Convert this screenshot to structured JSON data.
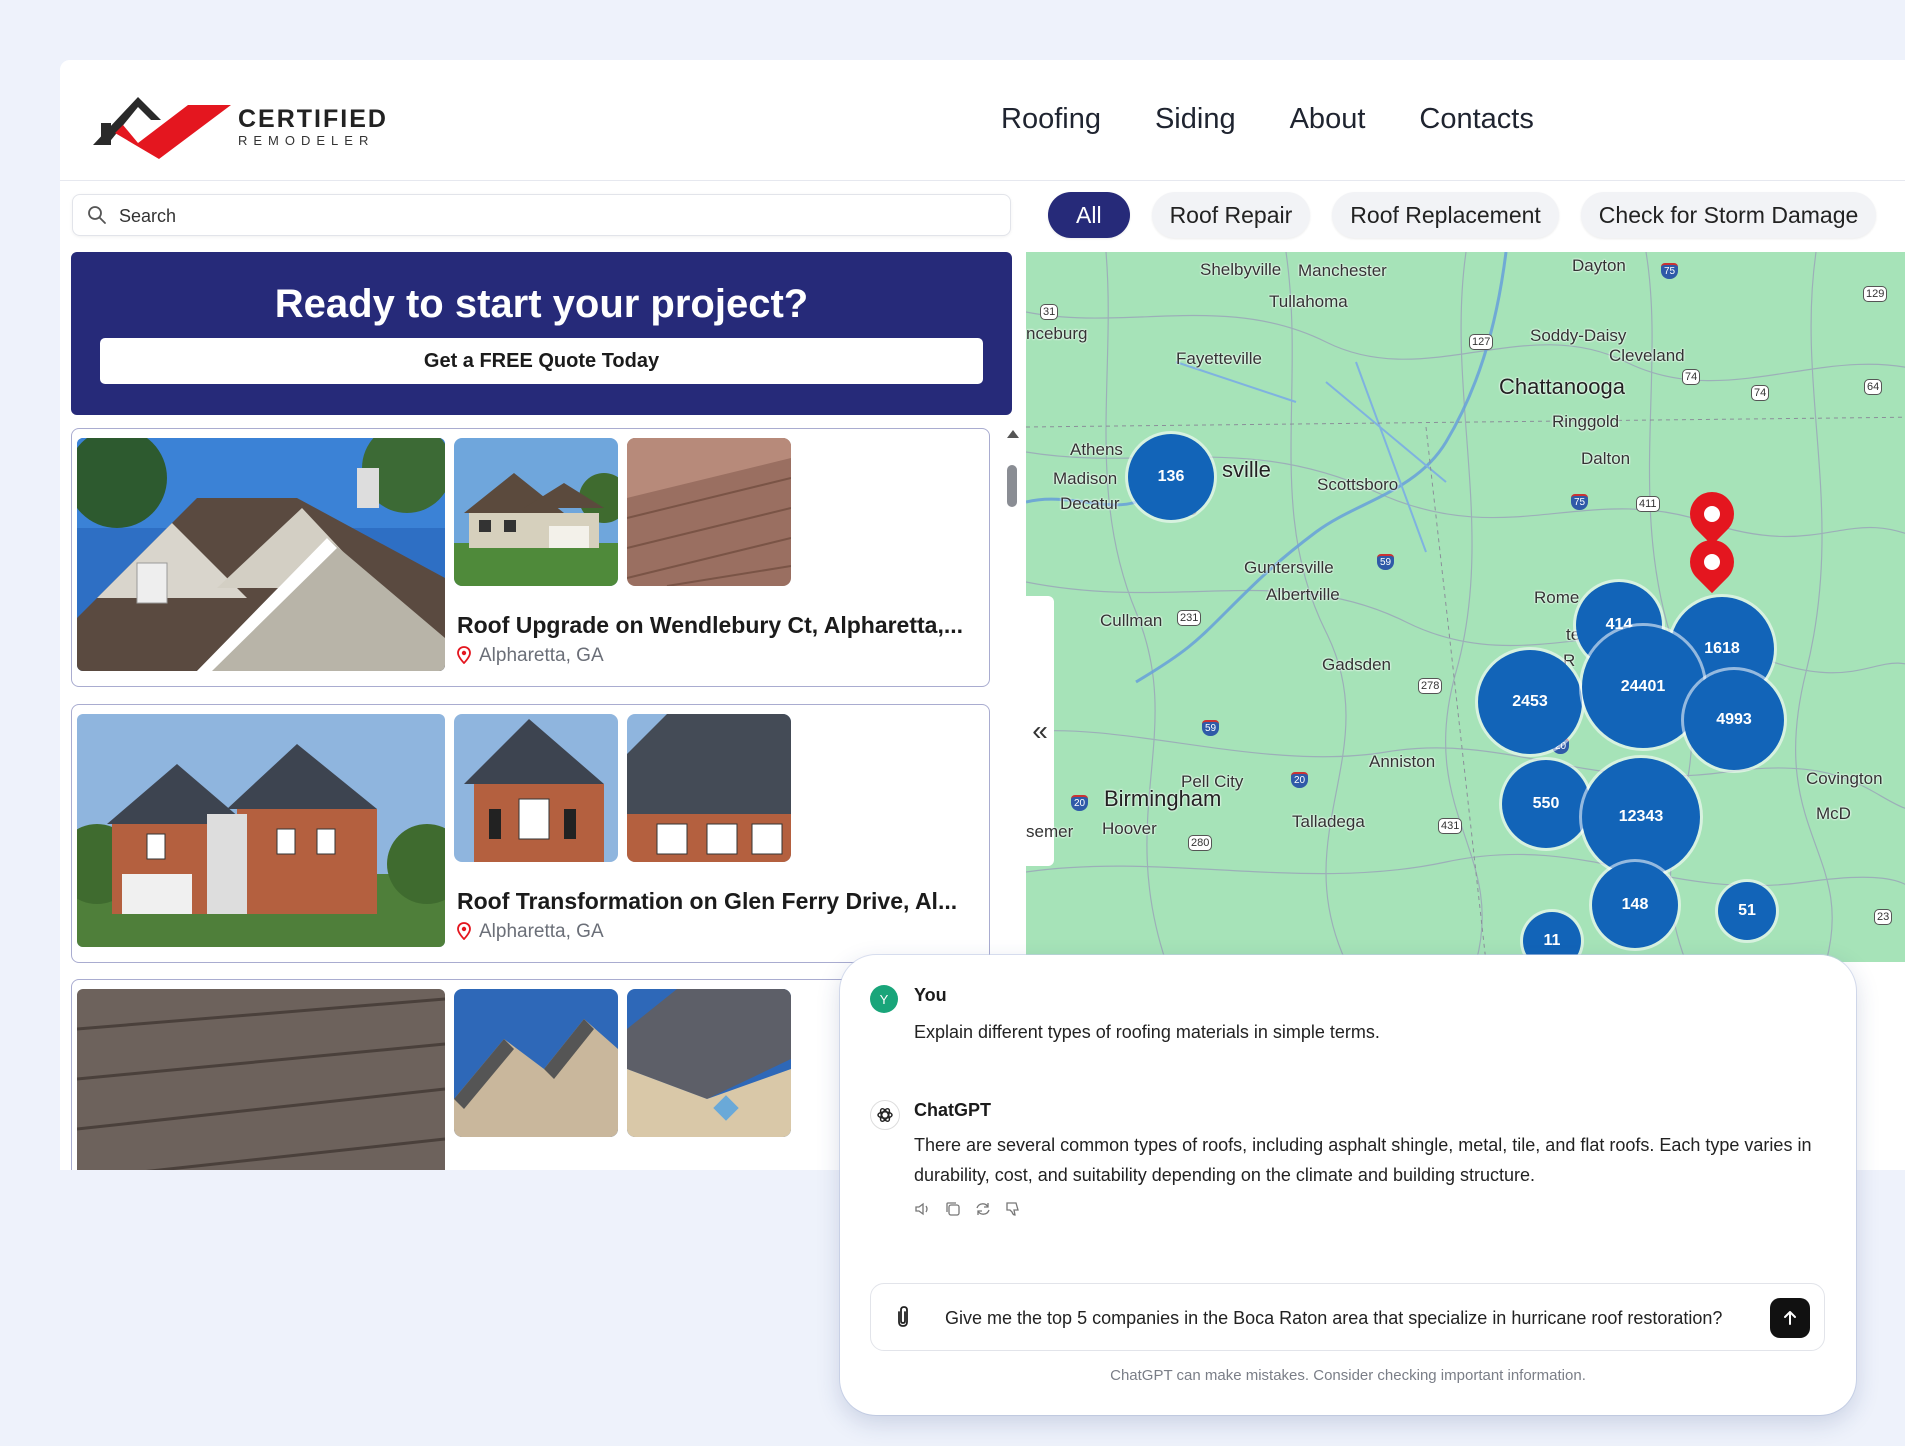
{
  "brand": {
    "title": "CERTIFIED",
    "subtitle": "REMODELER",
    "colors": {
      "primary": "#262a79",
      "accent": "#e4161f",
      "cluster": "#1264b8"
    }
  },
  "nav": [
    "Roofing",
    "Siding",
    "About",
    "Contacts"
  ],
  "search": {
    "placeholder": "Search",
    "icon": "search-icon"
  },
  "cta": {
    "title": "Ready to start your project?",
    "button": "Get a FREE Quote Today"
  },
  "filters": [
    {
      "label": "All",
      "active": true
    },
    {
      "label": "Roof Repair",
      "active": false
    },
    {
      "label": "Roof Replacement",
      "active": false
    },
    {
      "label": "Check for Storm Damage",
      "active": false
    }
  ],
  "listings": [
    {
      "title": "Roof Upgrade on Wendlebury Ct, Alpharetta,...",
      "location": "Alpharetta, GA"
    },
    {
      "title": "Roof Transformation on Glen Ferry Drive, Al...",
      "location": "Alpharetta, GA"
    },
    {
      "title": "",
      "location": ""
    }
  ],
  "map": {
    "collapse_icon": "double-chevron-left-icon",
    "places": [
      "Shelbyville",
      "Manchester",
      "Dayton",
      "Tullahoma",
      "nceburg",
      "Soddy-Daisy",
      "Fayetteville",
      "Cleveland",
      "Chattanooga",
      "Ringgold",
      "Athens",
      "Dalton",
      "Madison",
      "sville",
      "Scottsboro",
      "Decatur",
      "Guntersville",
      "Albertville",
      "Rome",
      "Cullman",
      "Gadsden",
      "Anniston",
      "Pell City",
      "Birmingham",
      "Covington",
      "Talladega",
      "semer",
      "Hoover",
      "McD",
      "tersv",
      "R",
      "a",
      "n"
    ],
    "route_shields": [
      "75",
      "129",
      "31",
      "127",
      "74",
      "74",
      "64",
      "231",
      "411",
      "75",
      "59",
      "231",
      "278",
      "59",
      "20",
      "20",
      "20",
      "85",
      "431",
      "280",
      "23"
    ],
    "clusters": [
      "136",
      "414",
      "1618",
      "2453",
      "24401",
      "4993",
      "550",
      "12343",
      "148",
      "51",
      "11"
    ]
  },
  "chat": {
    "user_name": "You",
    "user_initial": "Y",
    "user_message": "Explain different types of roofing materials in simple terms.",
    "assistant_name": "ChatGPT",
    "assistant_message": "There are several common types of roofs, including asphalt shingle, metal, tile, and flat roofs. Each type varies in durability, cost, and suitability depending on the climate and building structure.",
    "action_icons": [
      "speaker-icon",
      "copy-icon",
      "regenerate-icon",
      "thumbs-down-icon"
    ],
    "input_value": "Give me the top 5 companies in the Boca Raton area that specialize in hurricane roof restoration?",
    "disclaimer": "ChatGPT can make mistakes. Consider checking important information."
  }
}
